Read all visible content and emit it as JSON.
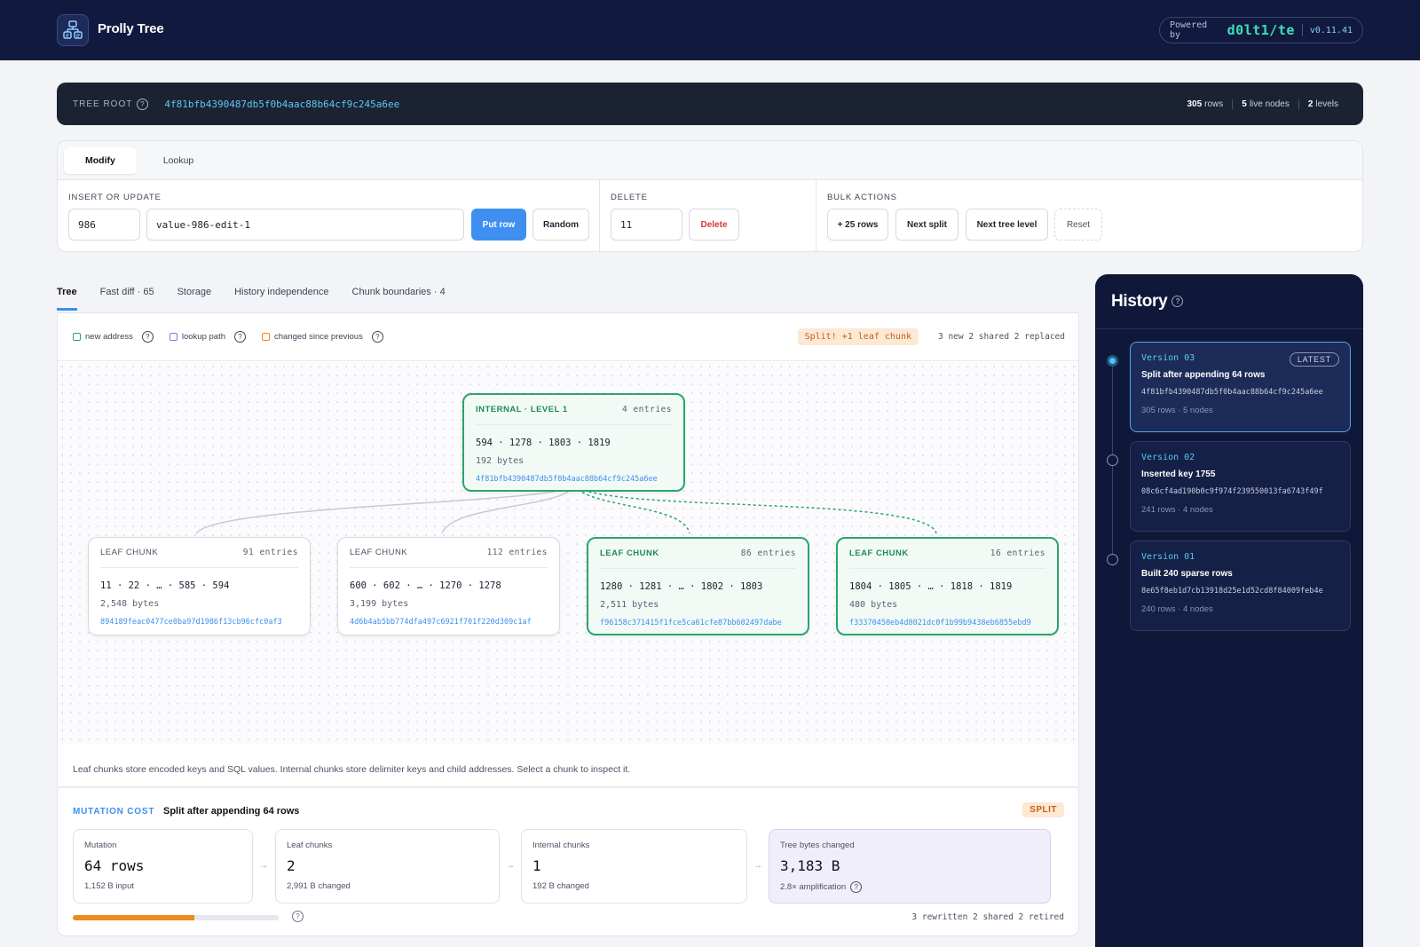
{
  "header": {
    "app_title": "Prolly Tree",
    "powered_label": "Powered by",
    "brand": "d0lt1/te",
    "version": "v0.11.41"
  },
  "root_bar": {
    "label": "TREE ROOT",
    "hash": "4f81bfb4390487db5f0b4aac88b64cf9c245a6ee",
    "stats": [
      {
        "value": "305",
        "label": "rows"
      },
      {
        "value": "5",
        "label": "live nodes"
      },
      {
        "value": "2",
        "label": "levels"
      }
    ]
  },
  "controls": {
    "tabs": [
      "Modify",
      "Lookup"
    ],
    "active_tab": "Modify",
    "insert": {
      "label": "INSERT OR UPDATE",
      "key_value": "986",
      "value_value": "value-986-edit-1",
      "put_label": "Put row",
      "random_label": "Random"
    },
    "delete": {
      "label": "DELETE",
      "key_value": "11",
      "delete_label": "Delete"
    },
    "bulk": {
      "label": "BULK ACTIONS",
      "buttons": [
        "+ 25 rows",
        "Next split",
        "Next tree level",
        "Reset"
      ]
    }
  },
  "main_tabs": [
    "Tree",
    "Fast diff · 65",
    "Storage",
    "History independence",
    "Chunk boundaries · 4"
  ],
  "legend": {
    "items": [
      {
        "label": "new address",
        "color": "#2aa56d"
      },
      {
        "label": "lookup path",
        "color": "#7b7fe0"
      },
      {
        "label": "changed since previous",
        "color": "#f08a1c"
      }
    ],
    "split_badge": "Split! +1 leaf chunk",
    "counts": "3 new  2 shared  2 replaced"
  },
  "tree": {
    "internal": {
      "type": "INTERNAL · LEVEL 1",
      "entries": "4 entries",
      "keys": "594 · 1278 · 1803 · 1819",
      "bytes": "192 bytes",
      "hash": "4f81bfb4390487db5f0b4aac88b64cf9c245a6ee"
    },
    "leaves": [
      {
        "type": "LEAF CHUNK",
        "entries": "91 entries",
        "keys": "11 · 22 · … · 585 · 594",
        "bytes": "2,548 bytes",
        "hash": "894189feac0477ce0ba97d1986f13cb96cfc0af3"
      },
      {
        "type": "LEAF CHUNK",
        "entries": "112 entries",
        "keys": "600 · 602 · … · 1270 · 1278",
        "bytes": "3,199 bytes",
        "hash": "4d6b4ab5bb774dfa497c6921f701f220d309c1af"
      },
      {
        "type": "LEAF CHUNK",
        "entries": "86 entries",
        "keys": "1280 · 1281 · … · 1802 · 1803",
        "bytes": "2,511 bytes",
        "hash": "f96158c371415f1fce5ca61cfe87bb602497dabe"
      },
      {
        "type": "LEAF CHUNK",
        "entries": "16 entries",
        "keys": "1804 · 1805 · … · 1818 · 1819",
        "bytes": "480 bytes",
        "hash": "f33370450eb4d8021dc0f1b99b9438eb6855ebd9"
      }
    ],
    "caption": "Leaf chunks store encoded keys and SQL values. Internal chunks store delimiter keys and child addresses. Select a chunk to inspect it."
  },
  "mutation_cost": {
    "label": "MUTATION COST",
    "title": "Split after appending 64 rows",
    "badge": "SPLIT",
    "boxes": [
      {
        "label": "Mutation",
        "value": "64 rows",
        "sub": "1,152 B input"
      },
      {
        "label": "Leaf chunks",
        "value": "2",
        "sub": "2,991 B changed"
      },
      {
        "label": "Internal chunks",
        "value": "1",
        "sub": "192 B changed"
      },
      {
        "label": "Tree bytes changed",
        "value": "3,183 B",
        "sub": "2.8× amplification"
      }
    ],
    "progress_fraction": 0.59,
    "stats": "3 rewritten  2 shared  2 retired"
  },
  "history": {
    "title": "History",
    "versions": [
      {
        "version": "Version 03",
        "latest": "LATEST",
        "desc": "Split after appending 64 rows",
        "hash": "4f81bfb4390487db5f0b4aac88b64cf9c245a6ee",
        "meta": "305 rows · 5 nodes"
      },
      {
        "version": "Version 02",
        "latest": "",
        "desc": "Inserted key 1755",
        "hash": "08c6cf4ad190b0c9f974f239550013fa6743f49f",
        "meta": "241 rows · 4 nodes"
      },
      {
        "version": "Version 01",
        "latest": "",
        "desc": "Built 240 sparse rows",
        "hash": "8e65f8eb1d7cb13918d25e1d52cd8f84009feb4e",
        "meta": "240 rows · 4 nodes"
      }
    ]
  }
}
